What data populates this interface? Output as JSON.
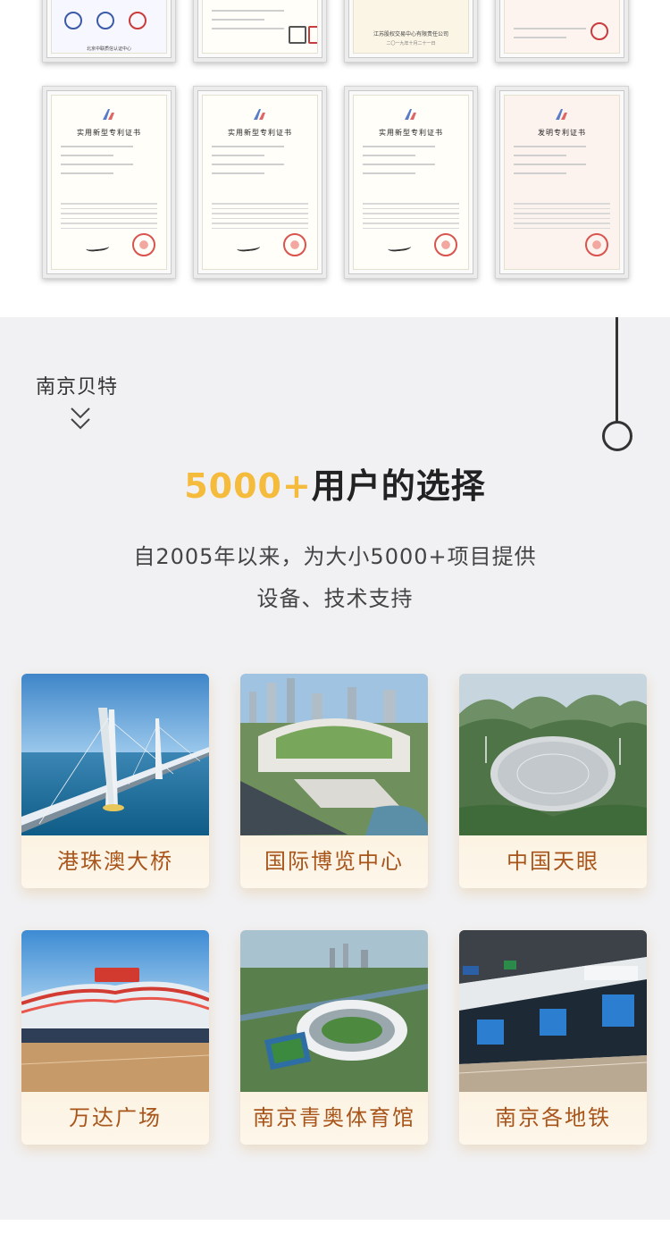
{
  "certificates": {
    "row_top": [
      {
        "text": "北京中联质信认证中心"
      },
      {
        "text": ""
      },
      {
        "text": "江苏股权交易中心有限责任公司",
        "date": "二〇一九年十月二十一日"
      },
      {
        "text": ""
      }
    ],
    "row_bottom": [
      {
        "title": "实用新型专利证书"
      },
      {
        "title": "实用新型专利证书"
      },
      {
        "title": "实用新型专利证书"
      },
      {
        "title": "发明专利证书"
      }
    ]
  },
  "brand": {
    "label": "南京贝特"
  },
  "headline": {
    "accent": "5000+",
    "rest": "用户的选择"
  },
  "subtitle": {
    "line1": "自2005年以来，为大小5000+项目提供",
    "line2": "设备、技术支持"
  },
  "projects": [
    {
      "label": "港珠澳大桥"
    },
    {
      "label": "国际博览中心"
    },
    {
      "label": "中国天眼"
    },
    {
      "label": "万达广场"
    },
    {
      "label": "南京青奥体育馆"
    },
    {
      "label": "南京各地铁"
    }
  ],
  "colors": {
    "accent": "#f5bb3c",
    "card_label": "#a8551b",
    "section_bg": "#f1f1f3"
  }
}
